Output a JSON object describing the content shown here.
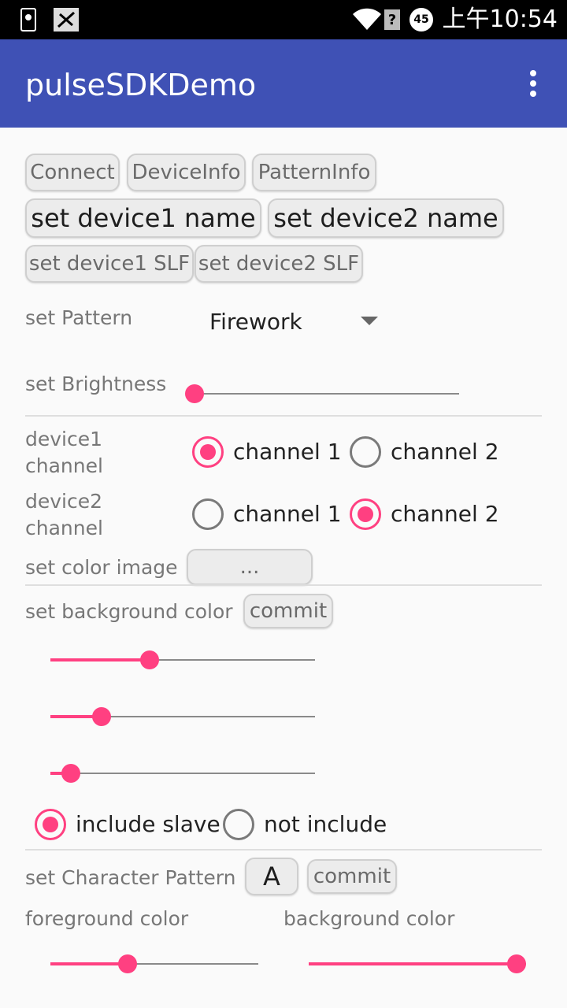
{
  "status_bar": {
    "time": "上午10:54",
    "battery_level": "45"
  },
  "app_bar": {
    "title": "pulseSDKDemo"
  },
  "buttons": {
    "connect": "Connect",
    "device_info": "DeviceInfo",
    "pattern_info": "PatternInfo",
    "set_device1_name": "set device1 name",
    "set_device2_name": "set device2 name",
    "set_device1_slf": "set device1 SLF",
    "set_device2_slf": "set device2 SLF"
  },
  "pattern": {
    "label": "set Pattern",
    "selected": "Firework"
  },
  "brightness": {
    "label": "set Brightness",
    "value": 0.0
  },
  "device1_channel": {
    "label_line1": "device1",
    "label_line2": "channel",
    "options": [
      "channel 1",
      "channel 2"
    ],
    "selected": "channel 1"
  },
  "device2_channel": {
    "label_line1": "device2",
    "label_line2": "channel",
    "options": [
      "channel 1",
      "channel 2"
    ],
    "selected": "channel 2"
  },
  "color_image": {
    "label": "set color image",
    "button": "..."
  },
  "background_color": {
    "label": "set background color",
    "commit": "commit",
    "sliders": [
      0.39,
      0.2,
      0.08
    ]
  },
  "slave": {
    "options": [
      "include slave",
      "not include"
    ],
    "selected": "include slave"
  },
  "character_pattern": {
    "label": "set Character Pattern",
    "letter": "A",
    "commit": "commit",
    "foreground_label": "foreground color",
    "background_label": "background color",
    "foreground_value": 0.39,
    "background_value": 1.0
  },
  "colors": {
    "primary": "#3f51b5",
    "accent": "#ff4081"
  }
}
